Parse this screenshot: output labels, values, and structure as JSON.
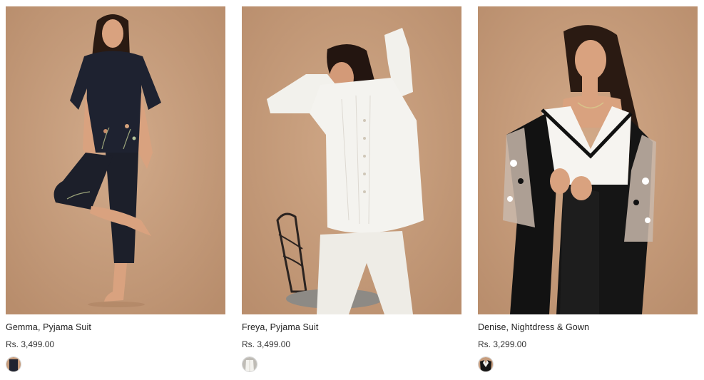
{
  "products": [
    {
      "name": "Gemma, Pyjama Suit",
      "price": "Rs. 3,499.00",
      "swatch_color": "#1f2330"
    },
    {
      "name": "Freya, Pyjama Suit",
      "price": "Rs. 3,499.00",
      "swatch_color": "#ededea"
    },
    {
      "name": "Denise, Nightdress & Gown",
      "price": "Rs. 3,299.00",
      "swatch_color": "#161616"
    }
  ],
  "colors": {
    "backdrop": "#c69c7c",
    "text": "#222222"
  }
}
